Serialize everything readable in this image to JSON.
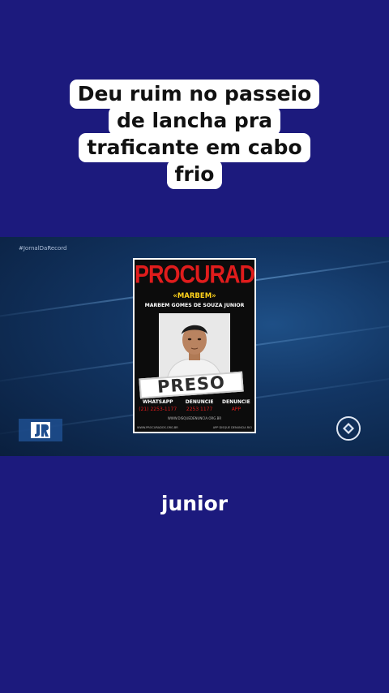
{
  "caption": {
    "lines": [
      "Deu ruim no passeio",
      "de lancha pra",
      "traficante em cabo",
      "frio"
    ]
  },
  "video": {
    "hashtag": "#JornalDaRecord",
    "poster": {
      "title": "PROCURADO",
      "alias": "«MARBEM»",
      "name": "MARBEM GOMES DE SOUZA JUNIOR",
      "stamp": "PRESO",
      "contacts": [
        {
          "label": "WHATSAPP",
          "phone": "(21) 2253-1177"
        },
        {
          "label": "DENUNCIE",
          "phone": "2253 1177"
        },
        {
          "label": "DENUNCIE",
          "phone": "APP"
        }
      ],
      "url": "WWW.DISQUEDENUNCIA.ORG.BR",
      "footer_left": "WWW.PROCURADOS.ORG.BR",
      "footer_right": "APP DISQUE DENUNCIA RIO"
    },
    "show_logo_icon": "jornal-da-record-logo-icon",
    "channel_logo_icon": "record-tv-logo-icon"
  },
  "subtitle": "junior",
  "colors": {
    "background": "#1c1a7d",
    "caption_bg": "#ffffff",
    "poster_red": "#e01c1c",
    "poster_yellow": "#ffd21a"
  }
}
